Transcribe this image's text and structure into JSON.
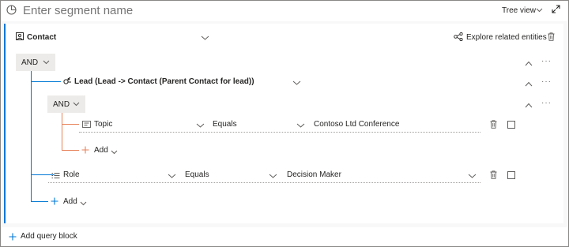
{
  "header": {
    "segment_name_placeholder": "Enter segment name",
    "view_mode": "Tree view"
  },
  "entity": {
    "name": "Contact",
    "explore_label": "Explore related entities"
  },
  "root_group": {
    "operator": "AND",
    "relationship": {
      "label": "Lead (Lead -> Contact (Parent Contact for lead))",
      "inner_group": {
        "operator": "AND",
        "condition": {
          "attribute": "Topic",
          "operator": "Equals",
          "value": "Contoso Ltd Conference"
        },
        "add_label": "Add"
      }
    },
    "condition": {
      "attribute": "Role",
      "operator": "Equals",
      "value": "Decision Maker"
    },
    "add_label": "Add"
  },
  "footer": {
    "add_query_block_label": "Add query block"
  },
  "colors": {
    "accent": "#0078d4",
    "nested_accent": "#e8825a",
    "group_bg": "#edebe9"
  },
  "icons": [
    "segment-icon",
    "chevron-down-icon",
    "expand-icon",
    "contact-entity-icon",
    "explore-icon",
    "delete-icon",
    "chevron-up-icon",
    "more-icon",
    "relationship-icon",
    "text-field-icon",
    "list-field-icon",
    "plus-icon"
  ]
}
